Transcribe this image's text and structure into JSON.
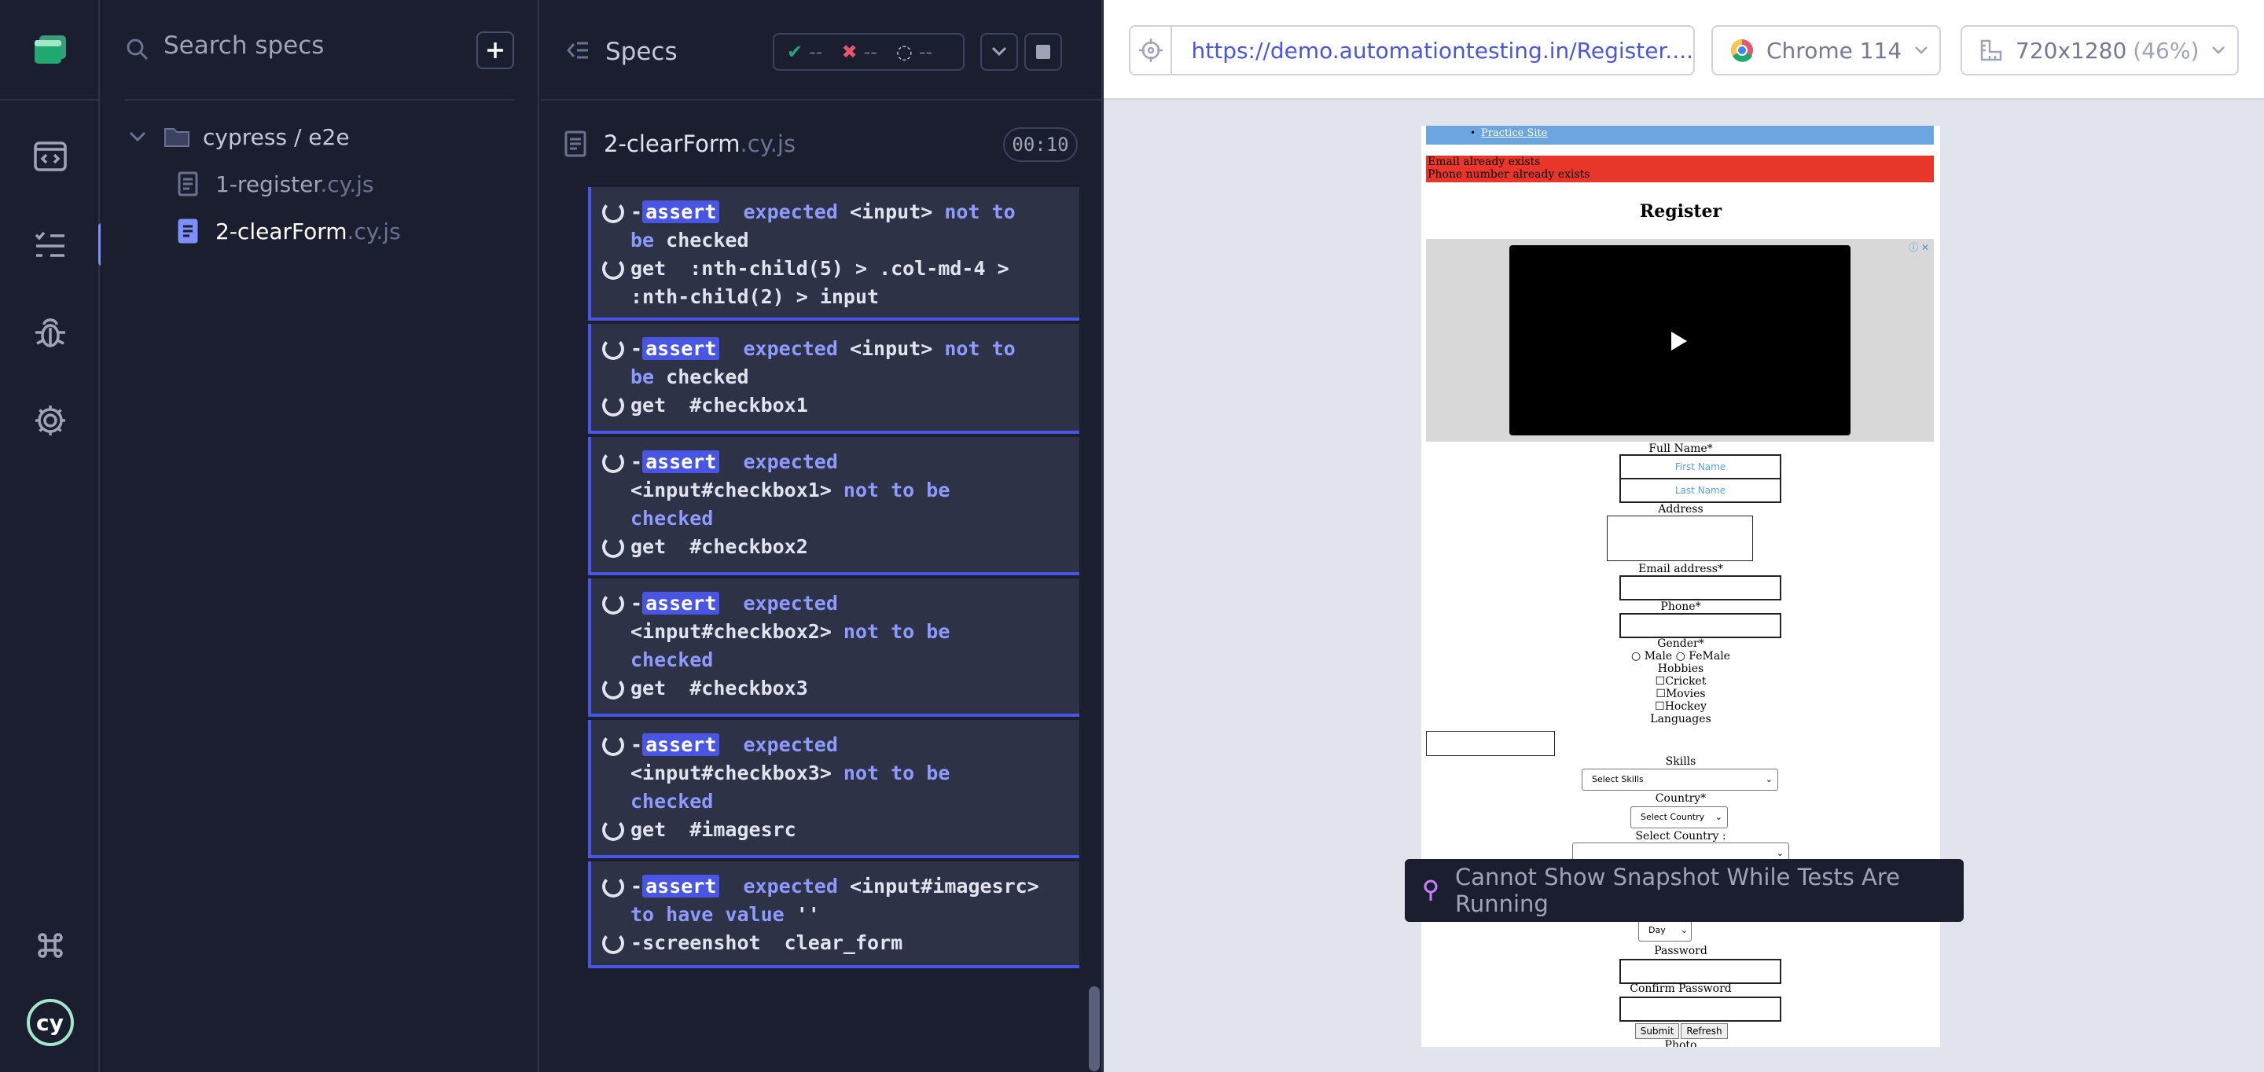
{
  "search": {
    "placeholder": "Search specs"
  },
  "tree": {
    "folder": "cypress / e2e",
    "files": [
      {
        "name": "1-register",
        "ext": ".cy.js"
      },
      {
        "name": "2-clearForm",
        "ext": ".cy.js"
      }
    ]
  },
  "reporter": {
    "title": "Specs",
    "stats": {
      "passed": "--",
      "failed": "--",
      "pending": "--"
    },
    "file": {
      "name": "2-clearForm",
      "ext": ".cy.js"
    },
    "timer": "00:10"
  },
  "commands": [
    {
      "lines": [
        {
          "dash": "-",
          "badge": "assert",
          "parts": [
            [
              "kw",
              "expected "
            ],
            [
              "tx",
              "<input>"
            ],
            [
              "kw",
              " not to be "
            ],
            [
              "tx",
              "checked"
            ]
          ]
        },
        {
          "dash": "",
          "badge": "",
          "parts": [
            [
              "tx",
              "get  :nth-child(5) > .col-md-4 > :nth-child(2) > input"
            ]
          ]
        }
      ]
    },
    {
      "lines": [
        {
          "dash": "-",
          "badge": "assert",
          "parts": [
            [
              "kw",
              "expected "
            ],
            [
              "tx",
              "<input>"
            ],
            [
              "kw",
              " not to be "
            ],
            [
              "tx",
              "checked"
            ]
          ]
        },
        {
          "dash": "",
          "badge": "",
          "parts": [
            [
              "tx",
              "get  #checkbox1"
            ]
          ]
        }
      ]
    },
    {
      "lines": [
        {
          "dash": "-",
          "badge": "assert",
          "parts": [
            [
              "kw",
              "expected "
            ],
            [
              "tx",
              "<input#checkbox1>"
            ],
            [
              "kw",
              " not to be checked"
            ]
          ]
        },
        {
          "dash": "",
          "badge": "",
          "parts": [
            [
              "tx",
              "get  #checkbox2"
            ]
          ]
        }
      ]
    },
    {
      "lines": [
        {
          "dash": "-",
          "badge": "assert",
          "parts": [
            [
              "kw",
              "expected "
            ],
            [
              "tx",
              "<input#checkbox2>"
            ],
            [
              "kw",
              " not to be checked"
            ]
          ]
        },
        {
          "dash": "",
          "badge": "",
          "parts": [
            [
              "tx",
              "get  #checkbox3"
            ]
          ]
        }
      ]
    },
    {
      "lines": [
        {
          "dash": "-",
          "badge": "assert",
          "parts": [
            [
              "kw",
              "expected "
            ],
            [
              "tx",
              "<input#checkbox3>"
            ],
            [
              "kw",
              " not to be checked"
            ]
          ]
        },
        {
          "dash": "",
          "badge": "",
          "parts": [
            [
              "tx",
              "get  #imagesrc"
            ]
          ]
        }
      ]
    },
    {
      "lines": [
        {
          "dash": "-",
          "badge": "assert",
          "parts": [
            [
              "kw",
              "expected "
            ],
            [
              "tx",
              "<input#imagesrc>"
            ],
            [
              "kw",
              " to have value "
            ],
            [
              "tx",
              "''"
            ]
          ]
        },
        {
          "dash": "-",
          "badge": "",
          "parts": [
            [
              "tx",
              "screenshot  clear_form"
            ]
          ]
        }
      ]
    }
  ],
  "browser": {
    "url": "https://demo.automationtesting.in/Register....",
    "name": "Chrome 114",
    "viewport": "720x1280",
    "scale": "(46%)"
  },
  "aut_page": {
    "nav_link": "Practice Site",
    "errors": [
      "Email already exists",
      "Phone number already exists"
    ],
    "title": "Register",
    "full_name": "Full Name*",
    "first_name": "First Name",
    "last_name": "Last Name",
    "address": "Address",
    "email": "Email address*",
    "phone": "Phone*",
    "gender": "Gender*",
    "male": "Male",
    "female": "FeMale",
    "hobbies": "Hobbies",
    "cricket": "Cricket",
    "movies": "Movies",
    "hockey": "Hockey",
    "languages": "Languages",
    "skills": "Skills",
    "select_skills": "Select Skills",
    "country": "Country*",
    "select_country": "Select Country",
    "select_country2": "Select Country :",
    "day": "Day",
    "password": "Password",
    "confirm_password": "Confirm Password",
    "submit": "Submit",
    "refresh": "Refresh",
    "photo": "Photo"
  },
  "toast": "Cannot Show Snapshot While Tests Are Running",
  "colors": {
    "accent": "#4956e3",
    "bg": "#1b1e2e",
    "panel": "#2e3247",
    "pass": "#1fa971",
    "fail": "#e45770"
  }
}
